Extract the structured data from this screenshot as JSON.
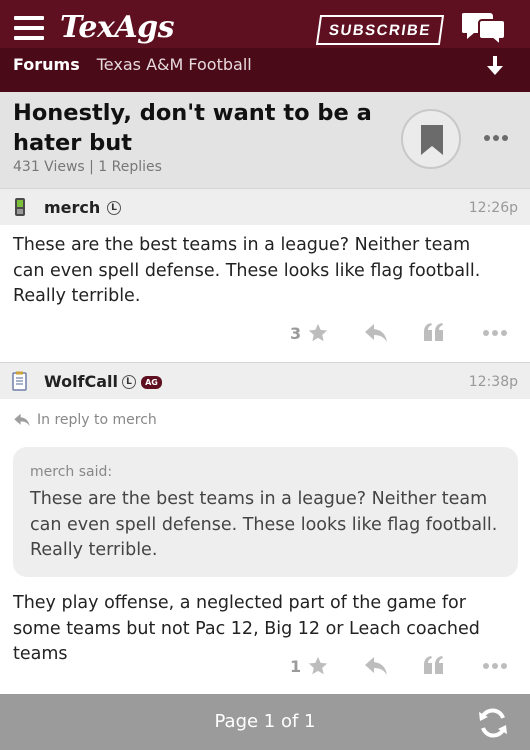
{
  "header": {
    "logo_text": "TexAgs",
    "subscribe_label": "SUBSCRIBE",
    "breadcrumb": {
      "forums": "Forums",
      "board": "Texas A&M Football"
    },
    "brand_color": "#5e0f20"
  },
  "thread": {
    "title": "Honestly, don't want to be a hater but",
    "meta": "431 Views | 1 Replies"
  },
  "posts": [
    {
      "username": "merch",
      "badge_l": "L",
      "time": "12:26p",
      "body": "These are the best teams in a league? Neither team can even spell defense. These looks like flag football. Really terrible.",
      "star_count": "3"
    },
    {
      "username": "WolfCall",
      "badge_l": "L",
      "badge_ag": "AG",
      "time": "12:38p",
      "reply_to": "In reply to merch",
      "quote_author": "merch said:",
      "quote_text": "These are the best teams in a league? Neither team can even spell defense. These looks like flag football. Really terrible.",
      "body": "They play offense, a neglected part of the game for some teams but not Pac 12, Big 12 or Leach coached teams",
      "star_count": "1"
    }
  ],
  "footer": {
    "page_label": "Page 1 of 1"
  }
}
